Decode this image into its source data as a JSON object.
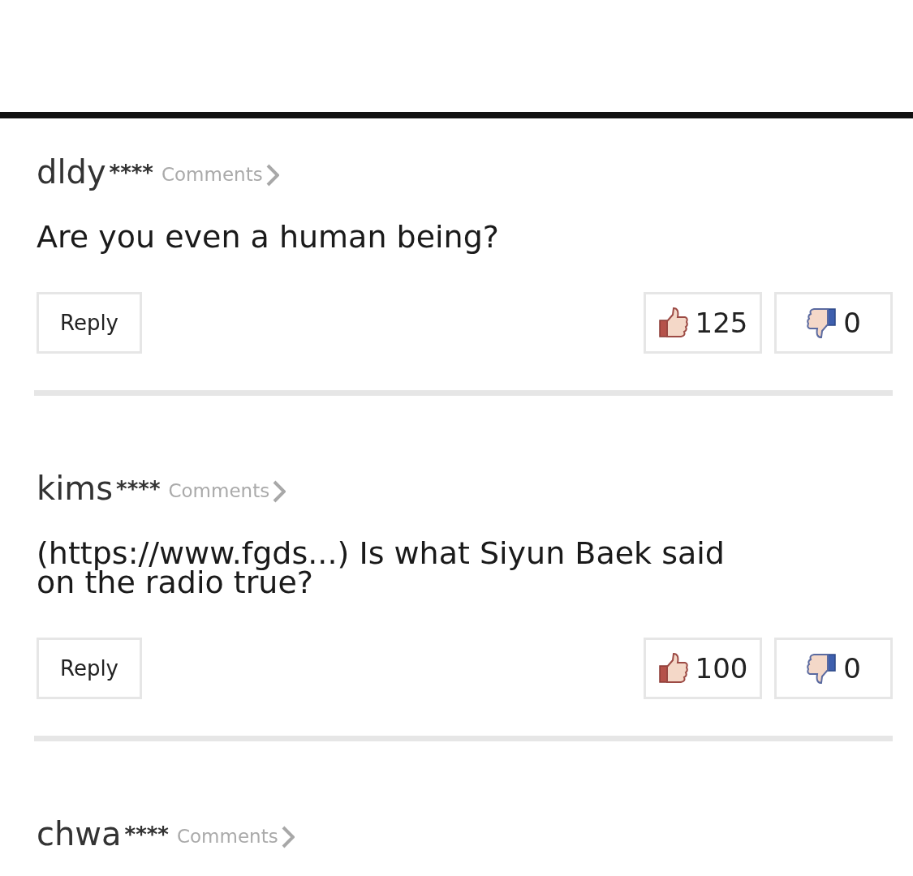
{
  "comments": [
    {
      "user": "dldy",
      "mask": "****",
      "link": "Comments",
      "body": "Are you even a human being?",
      "reply": "Reply",
      "likes": "125",
      "dislikes": "0"
    },
    {
      "user": "kims",
      "mask": "****",
      "link": "Comments",
      "body": "(https://www.fgds...) Is what Siyun Baek said on the radio true?",
      "reply": "Reply",
      "likes": "100",
      "dislikes": "0"
    },
    {
      "user": "chwa",
      "mask": "****",
      "link": "Comments"
    }
  ]
}
